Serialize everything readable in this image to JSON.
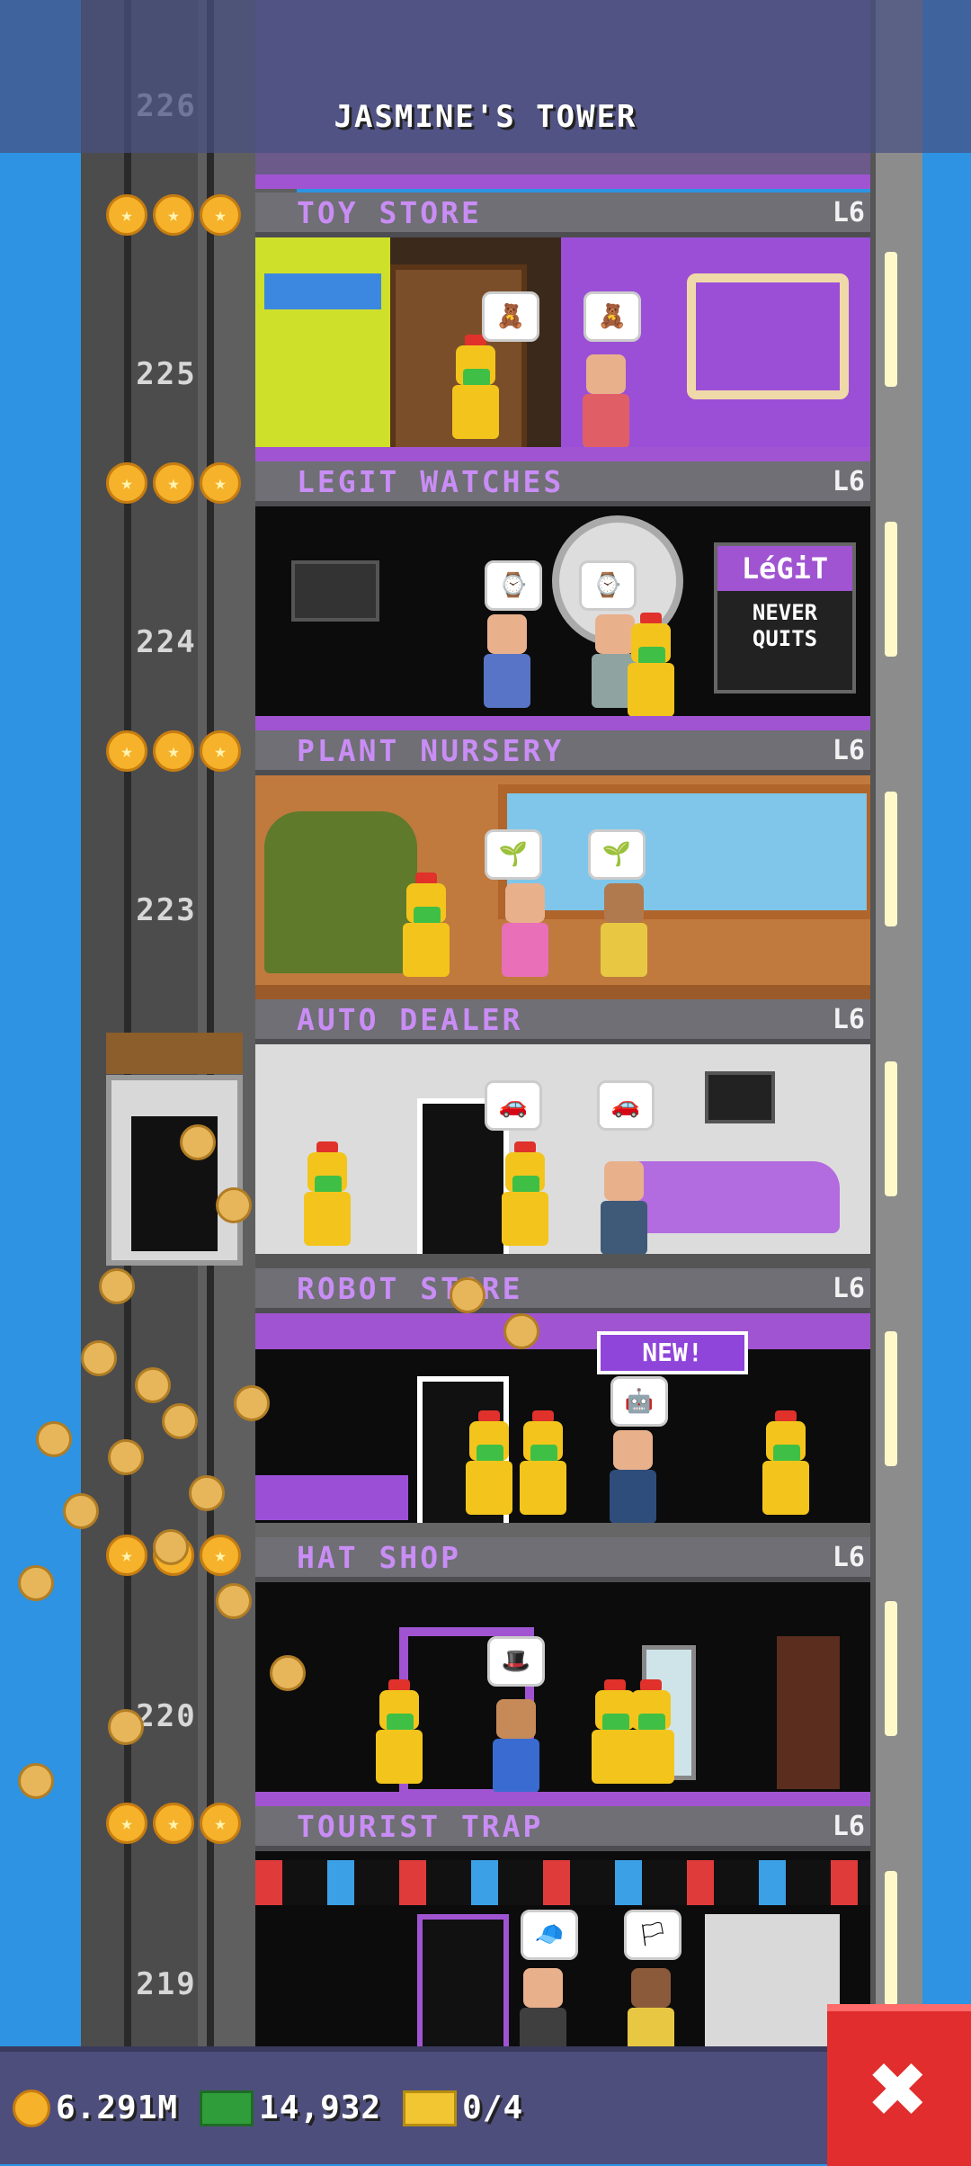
{
  "tower": {
    "title": "JASMINE'S TOWER"
  },
  "shaft_numbers": [
    "226",
    "225",
    "224",
    "223",
    "220",
    "219"
  ],
  "floors": [
    {
      "name": "TOY STORE",
      "level": "L6"
    },
    {
      "name": "LEGIT WATCHES",
      "level": "L6"
    },
    {
      "name": "PLANT NURSERY",
      "level": "L6"
    },
    {
      "name": "AUTO DEALER",
      "level": "L6"
    },
    {
      "name": "ROBOT STORE",
      "level": "L6"
    },
    {
      "name": "HAT SHOP",
      "level": "L6"
    },
    {
      "name": "TOURIST TRAP",
      "level": "L6"
    }
  ],
  "signs": {
    "legit_top": "LéGiT",
    "legit_bottom": "NEVER QUITS",
    "robot_new": "NEW!"
  },
  "resources": {
    "coins": "6.291M",
    "bux": "14,932",
    "tickets": "0/4"
  },
  "close_label": "✖",
  "colors": {
    "sky": "#2d93e2",
    "header_text": "#c98df5",
    "close": "#e12d2d"
  }
}
